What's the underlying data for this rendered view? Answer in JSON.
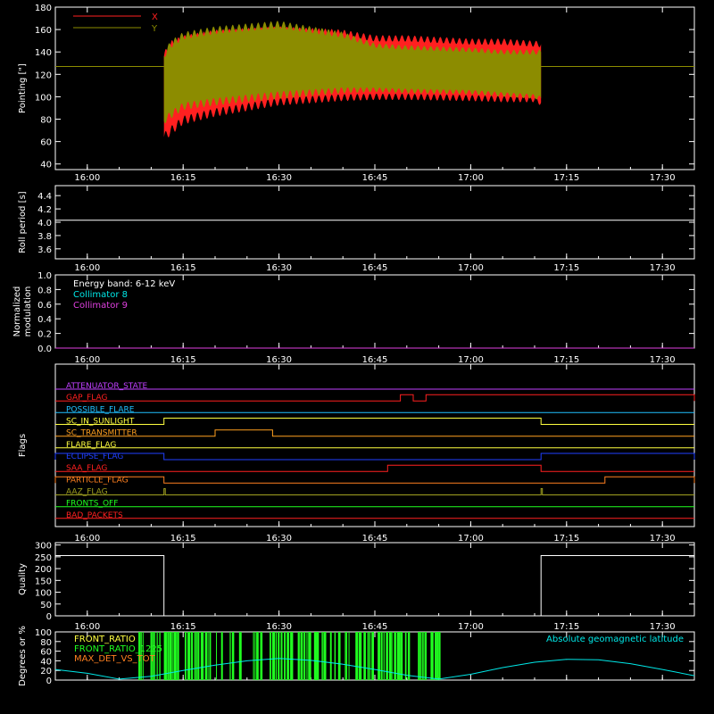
{
  "time_axis": {
    "range": [
      "15:55",
      "17:35"
    ],
    "ticks": [
      "16:00",
      "16:15",
      "16:30",
      "16:45",
      "17:00",
      "17:15",
      "17:30"
    ]
  },
  "chart_data": [
    {
      "type": "line",
      "ylabel": "Pointing [\"]",
      "ylim": [
        35,
        180
      ],
      "yticks": [
        "40",
        "60",
        "80",
        "100",
        "120",
        "140",
        "160",
        "180"
      ],
      "legend_placement": "top-left",
      "series": [
        {
          "name": "X",
          "color": "#ff2020"
        },
        {
          "name": "Y",
          "color": "#8c8c00"
        }
      ],
      "oscillation_period_min": 1.0,
      "baseline": {
        "value": 127,
        "color": "#8c8c00"
      },
      "x_envelope": {
        "x": [
          "16:12",
          "16:13",
          "16:15",
          "16:20",
          "16:30",
          "16:40",
          "16:45",
          "16:50",
          "17:00",
          "17:05",
          "17:10",
          "17:11"
        ],
        "upper": [
          140,
          150,
          155,
          160,
          163,
          160,
          155,
          155,
          152,
          152,
          150,
          150
        ],
        "lower": [
          60,
          65,
          75,
          82,
          92,
          96,
          97,
          97,
          96,
          95,
          95,
          92
        ]
      },
      "y_envelope": {
        "x": [
          "16:12",
          "16:13",
          "16:15",
          "16:20",
          "16:30",
          "16:40",
          "16:45",
          "16:50",
          "17:00",
          "17:05",
          "17:10",
          "17:11"
        ],
        "upper": [
          140,
          150,
          158,
          163,
          168,
          158,
          148,
          146,
          144,
          142,
          142,
          142
        ],
        "lower": [
          75,
          80,
          88,
          92,
          98,
          103,
          104,
          103,
          102,
          100,
          98,
          96
        ]
      }
    },
    {
      "type": "line",
      "ylabel": "Roll period [s]",
      "ylim": [
        3.45,
        4.55
      ],
      "yticks": [
        "3.6",
        "3.8",
        "4.0",
        "4.2",
        "4.4"
      ],
      "series": [
        {
          "x": [
            "15:55",
            "17:35"
          ],
          "y": [
            4.03,
            4.03
          ],
          "color": "#ffffff"
        }
      ]
    },
    {
      "type": "line",
      "ylabel": "Normalized\nmodulation",
      "ylim": [
        0,
        1
      ],
      "yticks": [
        "0.0",
        "0.2",
        "0.4",
        "0.6",
        "0.8",
        "1.0"
      ],
      "annotations": [
        {
          "text": "Energy band: 6-12 keV",
          "color": "#ffffff"
        },
        {
          "text": "Collimator 8",
          "color": "#00e8e8"
        },
        {
          "text": "Collimator 9",
          "color": "#e040e0"
        }
      ],
      "series": [
        {
          "name": "Collimator 9",
          "x": [
            "15:55",
            "17:35"
          ],
          "y": [
            0,
            0
          ],
          "color": "#e040e0"
        }
      ]
    },
    {
      "type": "line",
      "ylabel": "Flags",
      "series": [
        {
          "name": "ATTENUATOR_STATE",
          "color": "#c040ff",
          "transitions": []
        },
        {
          "name": "GAP_FLAG",
          "color": "#ff2020",
          "transitions": [
            [
              "16:49",
              "16:51"
            ],
            [
              "16:53",
              "17:35"
            ]
          ]
        },
        {
          "name": "POSSIBLE_FLARE",
          "color": "#20c0ff",
          "transitions": []
        },
        {
          "name": "SC_IN_SUNLIGHT",
          "color": "#ffff40",
          "transitions": [
            [
              "16:12",
              "17:11"
            ]
          ]
        },
        {
          "name": "SC_TRANSMITTER",
          "color": "#ffa020",
          "transitions": [
            [
              "16:20",
              "16:29"
            ]
          ]
        },
        {
          "name": "FLARE_FLAG",
          "color": "#ffff40",
          "transitions": []
        },
        {
          "name": "ECLIPSE_FLAG",
          "color": "#2040ff",
          "transitions": [
            [
              "15:55",
              "16:12"
            ],
            [
              "17:11",
              "17:35"
            ]
          ]
        },
        {
          "name": "SAA_FLAG",
          "color": "#ff2020",
          "transitions": [
            [
              "16:47",
              "17:11"
            ]
          ]
        },
        {
          "name": "PARTICLE_FLAG",
          "color": "#ff8020",
          "transitions": [
            [
              "15:55",
              "16:12"
            ],
            [
              "17:21",
              "17:35"
            ]
          ]
        },
        {
          "name": "AAZ_FLAG",
          "color": "#a0a020",
          "transitions": [
            [
              "16:12",
              "16:12"
            ],
            [
              "17:11",
              "17:11"
            ]
          ]
        },
        {
          "name": "FRONTS_OFF",
          "color": "#20ff20",
          "transitions": []
        },
        {
          "name": "BAD_PACKETS",
          "color": "#ff2020",
          "transitions": []
        }
      ]
    },
    {
      "type": "line",
      "ylabel": "Quality",
      "ylim": [
        0,
        310
      ],
      "yticks": [
        "0",
        "50",
        "100",
        "150",
        "200",
        "250",
        "300"
      ],
      "series": [
        {
          "x": [
            "15:55",
            "16:12",
            "16:12",
            "17:11",
            "17:11",
            "17:35"
          ],
          "y": [
            255,
            255,
            0,
            0,
            255,
            255
          ],
          "color": "#ffffff"
        }
      ]
    },
    {
      "type": "line",
      "ylabel": "Degrees or %",
      "ylim": [
        0,
        100
      ],
      "yticks": [
        "0",
        "20",
        "40",
        "60",
        "80",
        "100"
      ],
      "legend": [
        {
          "name": "FRONT_RATIO",
          "color": "#ffff40"
        },
        {
          "name": "FRONT_RATIO_1225",
          "color": "#20ff20"
        },
        {
          "name": "MAX_DET_VS_TOT",
          "color": "#ff8020"
        }
      ],
      "annotations": [
        {
          "text": "Absolute geomagnetic latitude",
          "color": "#00e8e8"
        }
      ],
      "series": [
        {
          "name": "Absolute geomagnetic latitude",
          "color": "#00e8e8",
          "x": [
            "15:55",
            "16:00",
            "16:05",
            "16:10",
            "16:15",
            "16:20",
            "16:25",
            "16:30",
            "16:35",
            "16:40",
            "16:45",
            "16:50",
            "16:55",
            "17:00",
            "17:05",
            "17:10",
            "17:15",
            "17:20",
            "17:25",
            "17:30",
            "17:35"
          ],
          "y": [
            22,
            14,
            2,
            8,
            20,
            31,
            40,
            45,
            41,
            33,
            22,
            10,
            2,
            12,
            26,
            37,
            43,
            42,
            34,
            22,
            9
          ]
        },
        {
          "name": "FRONT_RATIO_1225",
          "color": "#20ff20",
          "ranges": [
            [
              "16:08",
              "16:55"
            ]
          ]
        }
      ]
    }
  ]
}
